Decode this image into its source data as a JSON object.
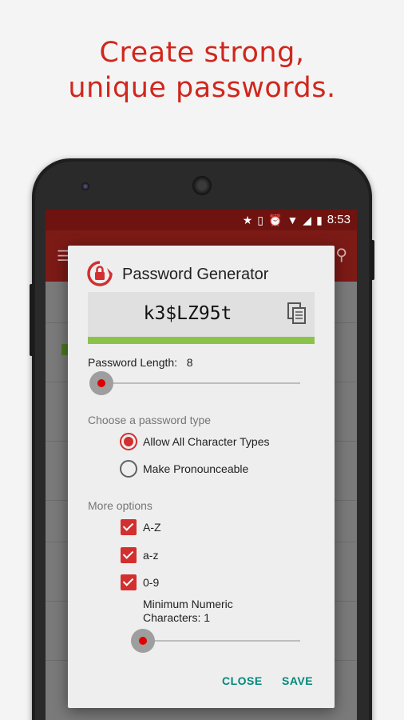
{
  "headline": {
    "line1": "Create strong,",
    "line2": "unique passwords."
  },
  "status_bar": {
    "time": "8:53",
    "icons": [
      "star-icon",
      "vibrate-icon",
      "alarm-icon",
      "wifi-icon",
      "signal-icon",
      "battery-icon"
    ]
  },
  "dialog": {
    "title": "Password Generator",
    "password": "k3$LZ95t",
    "strength_fraction": 1.0,
    "length_label": "Password Length:",
    "length_value": "8",
    "type_section": "Choose a password type",
    "type_options": [
      {
        "label": "Allow All Character Types",
        "selected": true
      },
      {
        "label": "Make Pronounceable",
        "selected": false
      }
    ],
    "more_section": "More options",
    "checks": [
      {
        "label": "A-Z",
        "checked": true
      },
      {
        "label": "a-z",
        "checked": true
      },
      {
        "label": "0-9",
        "checked": true
      }
    ],
    "min_numeric_line1": "Minimum Numeric",
    "min_numeric_line2": "Characters: 1",
    "close_label": "CLOSE",
    "save_label": "SAVE"
  },
  "colors": {
    "accent": "#d32f2f",
    "headline": "#d0271d",
    "strength": "#8bc34a",
    "button": "#00897b",
    "appbar": "#7c1a16"
  }
}
